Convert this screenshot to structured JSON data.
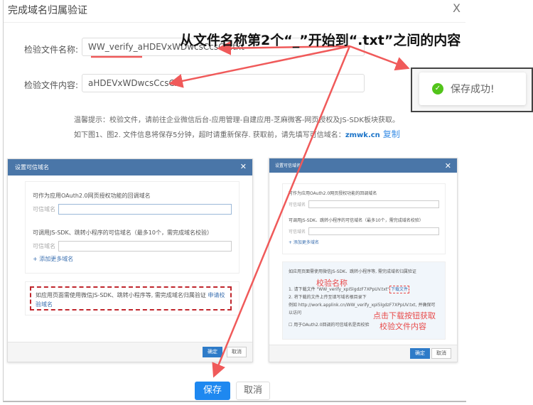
{
  "dialog": {
    "title": "完成域名归属验证",
    "close": "X"
  },
  "form": {
    "file_name_label": "检验文件名称:",
    "file_name_value": "WW_verify_aHDEVxWDwcsCcsCA.txt",
    "file_content_label": "检验文件内容:",
    "file_content_value": "aHDEVxWDwcsCcsCA"
  },
  "hint": {
    "line1": "温馨提示：校验文件，请前往企业微信后台-应用管理-自建应用-芝麻微客-网页授权及JS-SDK板块获取。",
    "line2": "如下图1、图2. 文件信息将保存5分钟，超时请重新保存. 获取前，请先填写可信域名：",
    "domain": "zmwk.cn",
    "copy": "复制"
  },
  "annotation": "从文件名称第2个“_”开始到“.txt”之间的内容",
  "toast": {
    "text": "保存成功!"
  },
  "buttons": {
    "save": "保存",
    "cancel": "取消"
  },
  "shot1": {
    "title": "设置可信域名",
    "close": "✕",
    "oauth_label": "可作为应用OAuth2.0网页授权功能的回调域名",
    "field_label": "可信域名",
    "jssdk_label": "可调用JS-SDK、跳转小程序的可信域名（最多10个，需完成域名校验）",
    "add_more": "+ 添加更多域名",
    "notice": "如应用页面需使用微信JS-SDK、跳转小程序等, 需完成域名归属验证",
    "apply_link": "申请校验域名",
    "ok": "确定",
    "cancel": "取消"
  },
  "shot2": {
    "title": "设置可信域名",
    "close": "✕",
    "oauth_label": "可作为应用OAuth2.0网页授权功能的回调域名",
    "field_label": "可信域名",
    "jssdk_label": "可调用JS-SDK、跳转小程序的可信域名（最多10个，需完成域名校验）",
    "add_more": "+ 添加更多域名",
    "notice": "如应用页面需使用微信JS-SDK、跳转小程序等, 需完成域名归属验证",
    "step1": "1. 请下载文件 \"WW_verify_xpI5lgdzF7XPpUV.txt\"",
    "download": "下载文件",
    "step2": "2. 将下载的文件上传至填写域名根目录下",
    "step2b": "例如 http://work.applink.cn/WW_verify_xpI5lgdzF7XPpUV.txt, 并确保可以访问",
    "checkbox": "用于OAuth2.0回调的可信域名是否校验",
    "anno_name": "校验名称",
    "anno_click": "点击下载按钮获取",
    "anno_content": "校验文件内容",
    "ok": "确定",
    "cancel": "取消"
  }
}
